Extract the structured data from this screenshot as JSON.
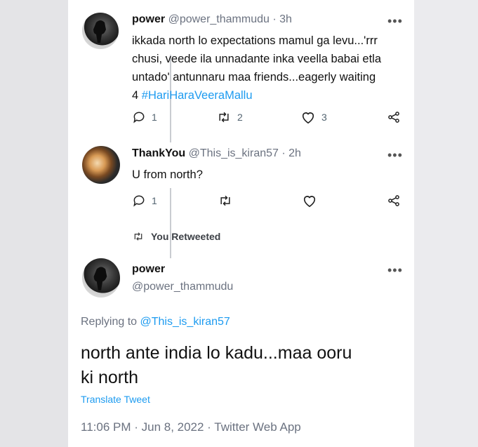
{
  "tweets": [
    {
      "name": "power",
      "handle": "@power_thammudu",
      "time": "· 3h",
      "lines": [
        "ikkada north lo expectations mamul ga levu...'rrr",
        "chusi, veede ila unnadante inka veella babai etla",
        "untado' antunnaru maa friends...eagerly waiting"
      ],
      "last_prefix": "4 ",
      "hashtag": "#HariHaraVeeraMallu",
      "counts": {
        "replies": "1",
        "retweets": "2",
        "likes": "3"
      }
    },
    {
      "name": "ThankYou",
      "handle": "@This_is_kiran57",
      "time": "· 2h",
      "text": "U from north?",
      "counts": {
        "replies": "1"
      }
    }
  ],
  "retweet_note": "You Retweeted",
  "main": {
    "name": "power",
    "handle": "@power_thammudu",
    "replying_prefix": "Replying to ",
    "replying_handle": "@This_is_kiran57",
    "text_line1": "north ante india lo kadu...maa ooru",
    "text_line2": "ki north",
    "translate": "Translate Tweet",
    "timestamp": "11:06 PM · Jun 8, 2022 · Twitter Web App"
  },
  "more_glyph": "•••",
  "colors": {
    "link": "#1d9bf0",
    "muted": "#536471",
    "thread": "#c9ccd1"
  },
  "icons": [
    "reply-icon",
    "retweet-icon",
    "like-icon",
    "share-icon",
    "more-icon",
    "avatar"
  ]
}
